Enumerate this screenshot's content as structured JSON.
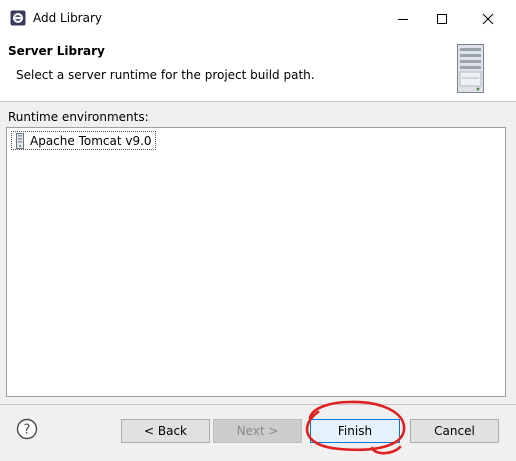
{
  "window": {
    "title": "Add Library",
    "icons": [
      "app-icon",
      "minimize-icon",
      "maximize-icon",
      "close-icon"
    ]
  },
  "header": {
    "title": "Server Library",
    "description": "Select a server runtime for the project build path.",
    "icon": "server-icon"
  },
  "runtime": {
    "label": "Runtime environments:",
    "items": [
      {
        "label": "Apache Tomcat v9.0",
        "icon": "server-runtime-icon",
        "selected": true
      }
    ]
  },
  "buttons": {
    "back": "< Back",
    "next": "Next >",
    "finish": "Finish",
    "cancel": "Cancel",
    "next_enabled": false
  },
  "colors": {
    "annotation": "#e0201e",
    "finish_border": "#0078d7"
  }
}
